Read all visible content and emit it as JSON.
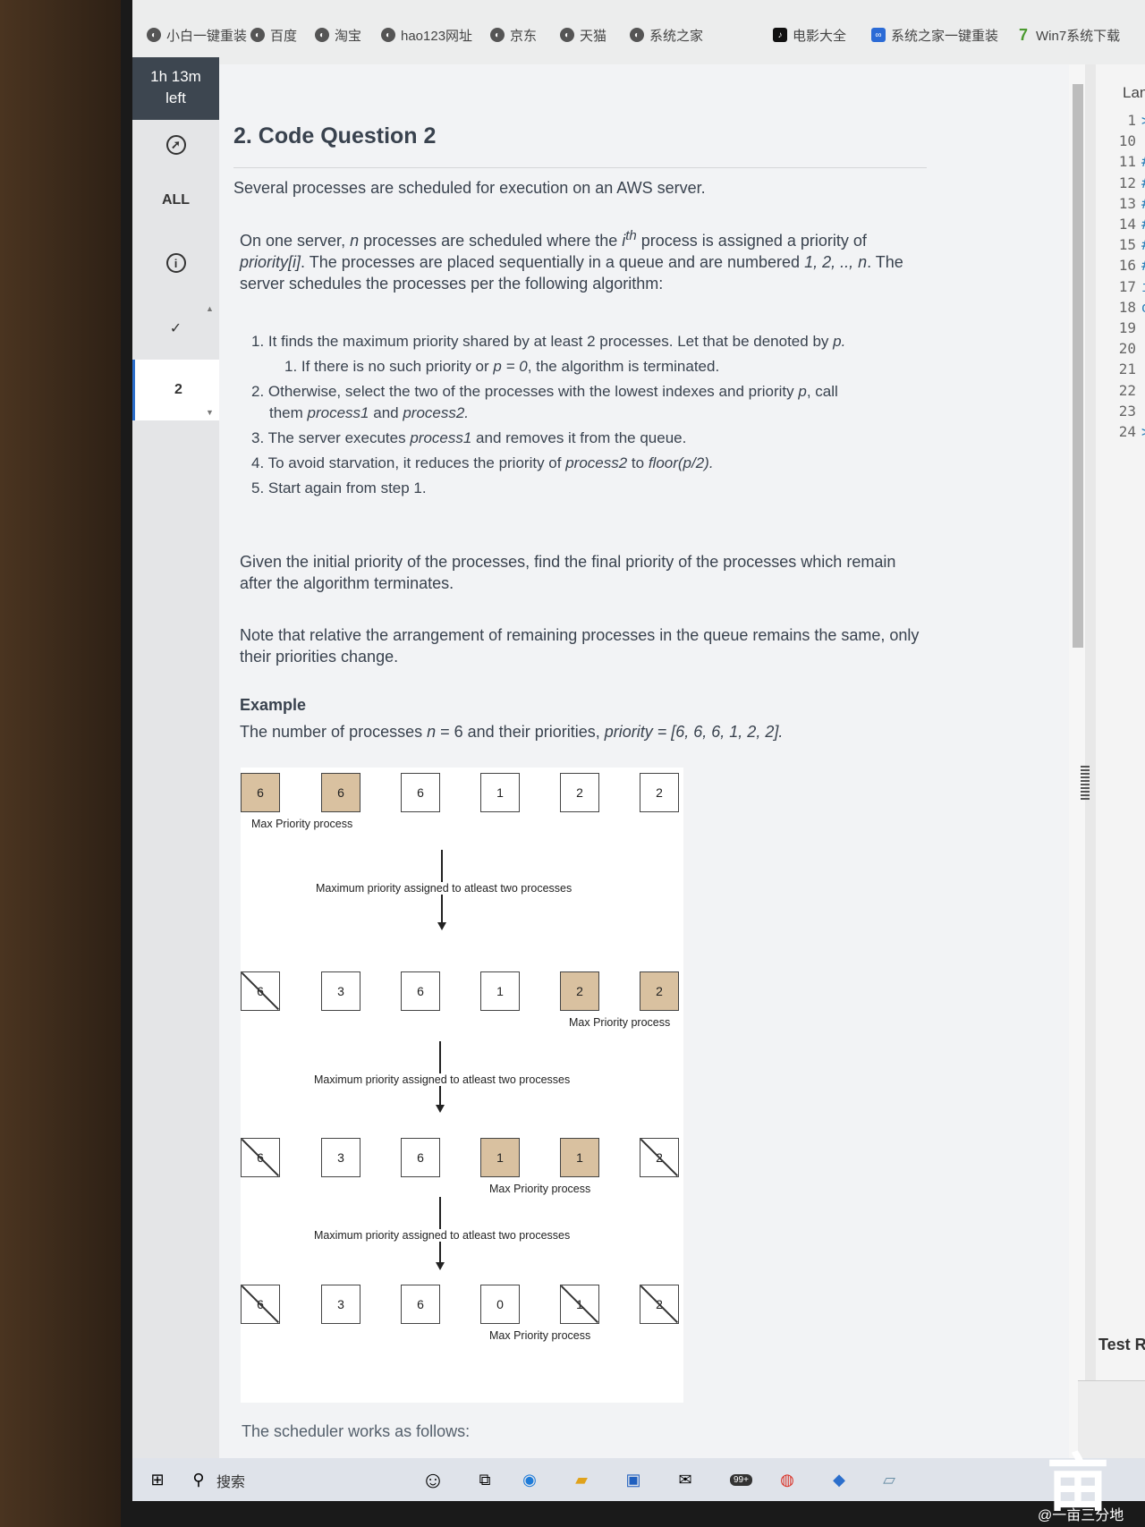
{
  "bookmarks": [
    {
      "label": "小白一键重装",
      "icon": "globe-icon"
    },
    {
      "label": "百度",
      "icon": "globe-icon"
    },
    {
      "label": "淘宝",
      "icon": "globe-icon"
    },
    {
      "label": "hao123网址",
      "icon": "globe-icon"
    },
    {
      "label": "京东",
      "icon": "globe-icon"
    },
    {
      "label": "天猫",
      "icon": "globe-icon"
    },
    {
      "label": "系统之家",
      "icon": "globe-icon"
    },
    {
      "label": "电影大全",
      "icon": "tiktok-icon"
    },
    {
      "label": "系统之家一键重装",
      "icon": "app-icon"
    },
    {
      "label": "Win7系统下载",
      "icon": "seven-icon"
    }
  ],
  "timer": {
    "line1": "1h 13m",
    "line2": "left"
  },
  "nav": {
    "all_label": "ALL",
    "question_number": "2",
    "check_glyph": "✓",
    "info_glyph": "i"
  },
  "question": {
    "title": "2. Code Question 2",
    "intro": "Several processes are scheduled for execution on an AWS server.",
    "p1_a": "On one server, ",
    "p1_n": "n",
    "p1_b": " processes are scheduled where the ",
    "p1_i": "i",
    "p1_th": "th",
    "p1_c": " process is assigned a priority of",
    "p1_d": "priority[i]",
    "p1_e": ". The processes are placed sequentially in a queue and are numbered ",
    "p1_f": "1, 2, .., n",
    "p1_g": ". The",
    "p1_h": "server schedules the processes per the following algorithm:",
    "steps": {
      "s1": "1. It finds the maximum priority shared by at least 2 processes. Let that be denoted by ",
      "s1_p": "p.",
      "s1_1a": "1. If there is no such priority or ",
      "s1_1p": "p = 0",
      "s1_1b": ", the algorithm is terminated.",
      "s2a": "2. Otherwise, select the two of the processes with the lowest indexes and priority ",
      "s2p": "p",
      "s2b": ", call",
      "s2c": "them ",
      "s2d": "process1",
      "s2e": " and ",
      "s2f": "process2.",
      "s3a": "3. The server executes ",
      "s3b": "process1",
      "s3c": " and removes it from the queue.",
      "s4a": "4. To avoid starvation, it reduces the priority of ",
      "s4b": "process2",
      "s4c": " to ",
      "s4d": "floor(p/2).",
      "s5": "5. Start again from step 1."
    },
    "given": "Given the initial priority of the processes, find the final priority of the processes which remain after the algorithm terminates.",
    "note": "Note that relative the arrangement of remaining processes in the queue remains the same, only their priorities change.",
    "example_title": "Example",
    "example_a": "The number of processes ",
    "example_n": "n",
    "example_b": " = 6 and their priorities, ",
    "example_c": "priority = [6, 6, 6, 1, 2, 2].",
    "scheduler": "The scheduler works as follows:"
  },
  "diagram": {
    "rows": [
      {
        "values": [
          "6",
          "6",
          "6",
          "1",
          "2",
          "2"
        ],
        "highlight": [
          0,
          1
        ],
        "crossed": []
      },
      {
        "values": [
          "6",
          "3",
          "6",
          "1",
          "2",
          "2"
        ],
        "highlight": [
          4,
          5
        ],
        "crossed": [
          0
        ]
      },
      {
        "values": [
          "6",
          "3",
          "6",
          "1",
          "1",
          "2"
        ],
        "highlight": [
          3,
          4
        ],
        "crossed": [
          0,
          5
        ]
      },
      {
        "values": [
          "6",
          "3",
          "6",
          "0",
          "1",
          "2"
        ],
        "highlight": [],
        "crossed": [
          0,
          4,
          5
        ]
      }
    ],
    "max_label": "Max Priority process",
    "arrow_label": "Maximum priority assigned to atleast two processes",
    "highlight_color": "#d9c1a0"
  },
  "editor": {
    "language_label": "Language",
    "lines": [
      {
        "n": "1",
        "code": "> #!"
      },
      {
        "n": "10",
        "code": ""
      },
      {
        "n": "11",
        "code": "#"
      },
      {
        "n": "12",
        "code": "#"
      },
      {
        "n": "13",
        "code": "#"
      },
      {
        "n": "14",
        "code": "#"
      },
      {
        "n": "15",
        "code": "#"
      },
      {
        "n": "16",
        "code": "#"
      },
      {
        "n": "17",
        "code": "imp"
      },
      {
        "n": "18",
        "code": "def"
      },
      {
        "n": "19",
        "code": ""
      },
      {
        "n": "20",
        "code": ""
      },
      {
        "n": "21",
        "code": ""
      },
      {
        "n": "22",
        "code": ""
      },
      {
        "n": "23",
        "code": ""
      },
      {
        "n": "24",
        "code": "> if"
      }
    ],
    "test_results": "Test Result"
  },
  "taskbar": {
    "search_label": "搜索",
    "badge": "99+"
  },
  "watermark": {
    "text": "@一亩三分地",
    "glyph": "亩"
  }
}
